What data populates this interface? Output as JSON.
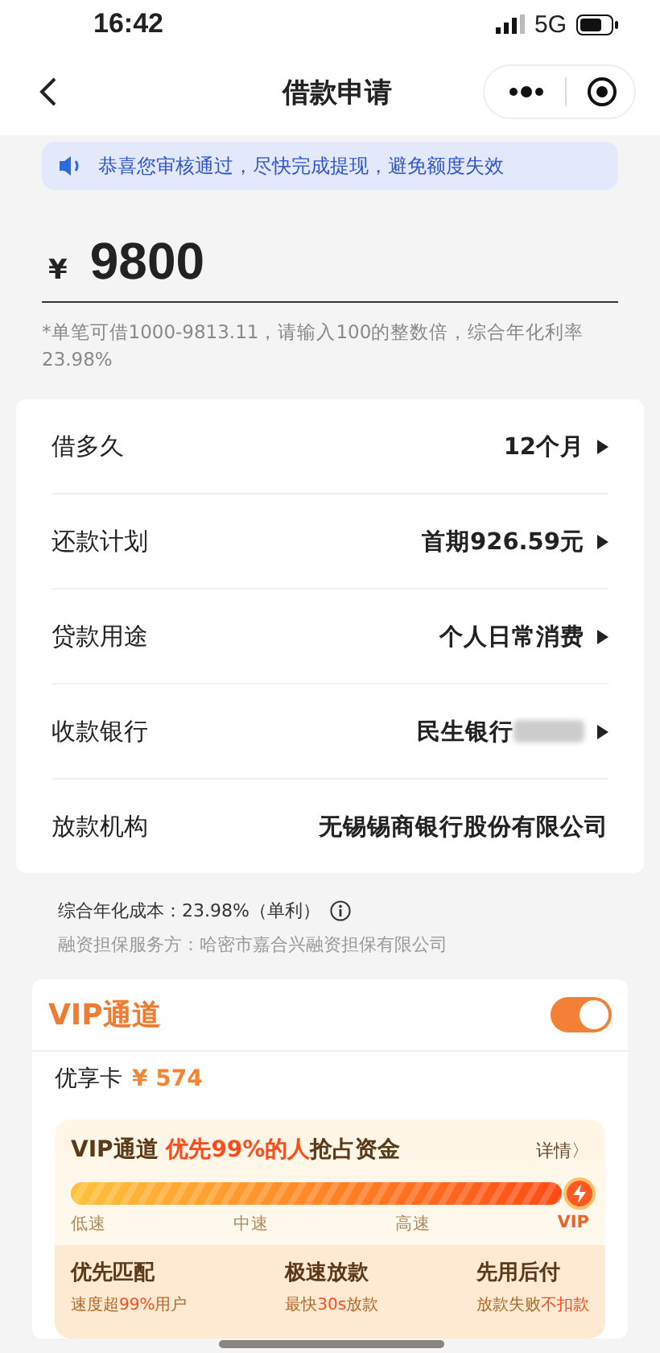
{
  "status_bar": {
    "time": "16:42",
    "network": "5G"
  },
  "nav": {
    "title": "借款申请"
  },
  "notice": {
    "text": "恭喜您审核通过，尽快完成提现，避免额度失效"
  },
  "amount": {
    "currency": "¥",
    "value": "9800"
  },
  "amount_hint": "*单笔可借1000-9813.11，请输入100的整数倍，综合年化利率23.98%",
  "details": [
    {
      "label": "借多久",
      "value": "12个月",
      "arrow": true,
      "masked": false
    },
    {
      "label": "还款计划",
      "value": "首期926.59元",
      "arrow": true,
      "masked": false
    },
    {
      "label": "贷款用途",
      "value": "个人日常消费",
      "arrow": true,
      "masked": false
    },
    {
      "label": "收款银行",
      "value": "民生银行",
      "arrow": true,
      "masked": true
    },
    {
      "label": "放款机构",
      "value": "无锡锡商银行股份有限公司",
      "arrow": false,
      "masked": false
    }
  ],
  "cost": {
    "label": "综合年化成本：",
    "value": "23.98%（单利）"
  },
  "guarantor": "融资担保服务方：哈密市嘉合兴融资担保有限公司",
  "vip": {
    "title": "VIP通道",
    "on": true,
    "card_label": "优享卡",
    "card_price": "¥ 574",
    "headline": [
      {
        "text": "VIP通道 ",
        "highlight": false
      },
      {
        "text": "优先99%的人",
        "highlight": true
      },
      {
        "text": "抢占资金",
        "highlight": false
      }
    ],
    "details_link": "详情〉",
    "level": 1,
    "speeds": [
      {
        "label": "低速",
        "selected": false
      },
      {
        "label": "中速",
        "selected": false
      },
      {
        "label": "高速",
        "selected": false
      },
      {
        "label": "VIP",
        "selected": true
      }
    ],
    "benefits": [
      {
        "title": "优先匹配",
        "parts": [
          {
            "text": "速度超",
            "highlight": false
          },
          {
            "text": "99%",
            "highlight": true
          },
          {
            "text": "用户",
            "highlight": false
          }
        ]
      },
      {
        "title": "极速放款",
        "parts": [
          {
            "text": "最快",
            "highlight": false
          },
          {
            "text": "30s",
            "highlight": true
          },
          {
            "text": "放款",
            "highlight": false
          }
        ]
      },
      {
        "title": "先用后付",
        "parts": [
          {
            "text": "放款失败",
            "highlight": false
          },
          {
            "text": "不扣款",
            "highlight": true
          }
        ]
      }
    ]
  }
}
